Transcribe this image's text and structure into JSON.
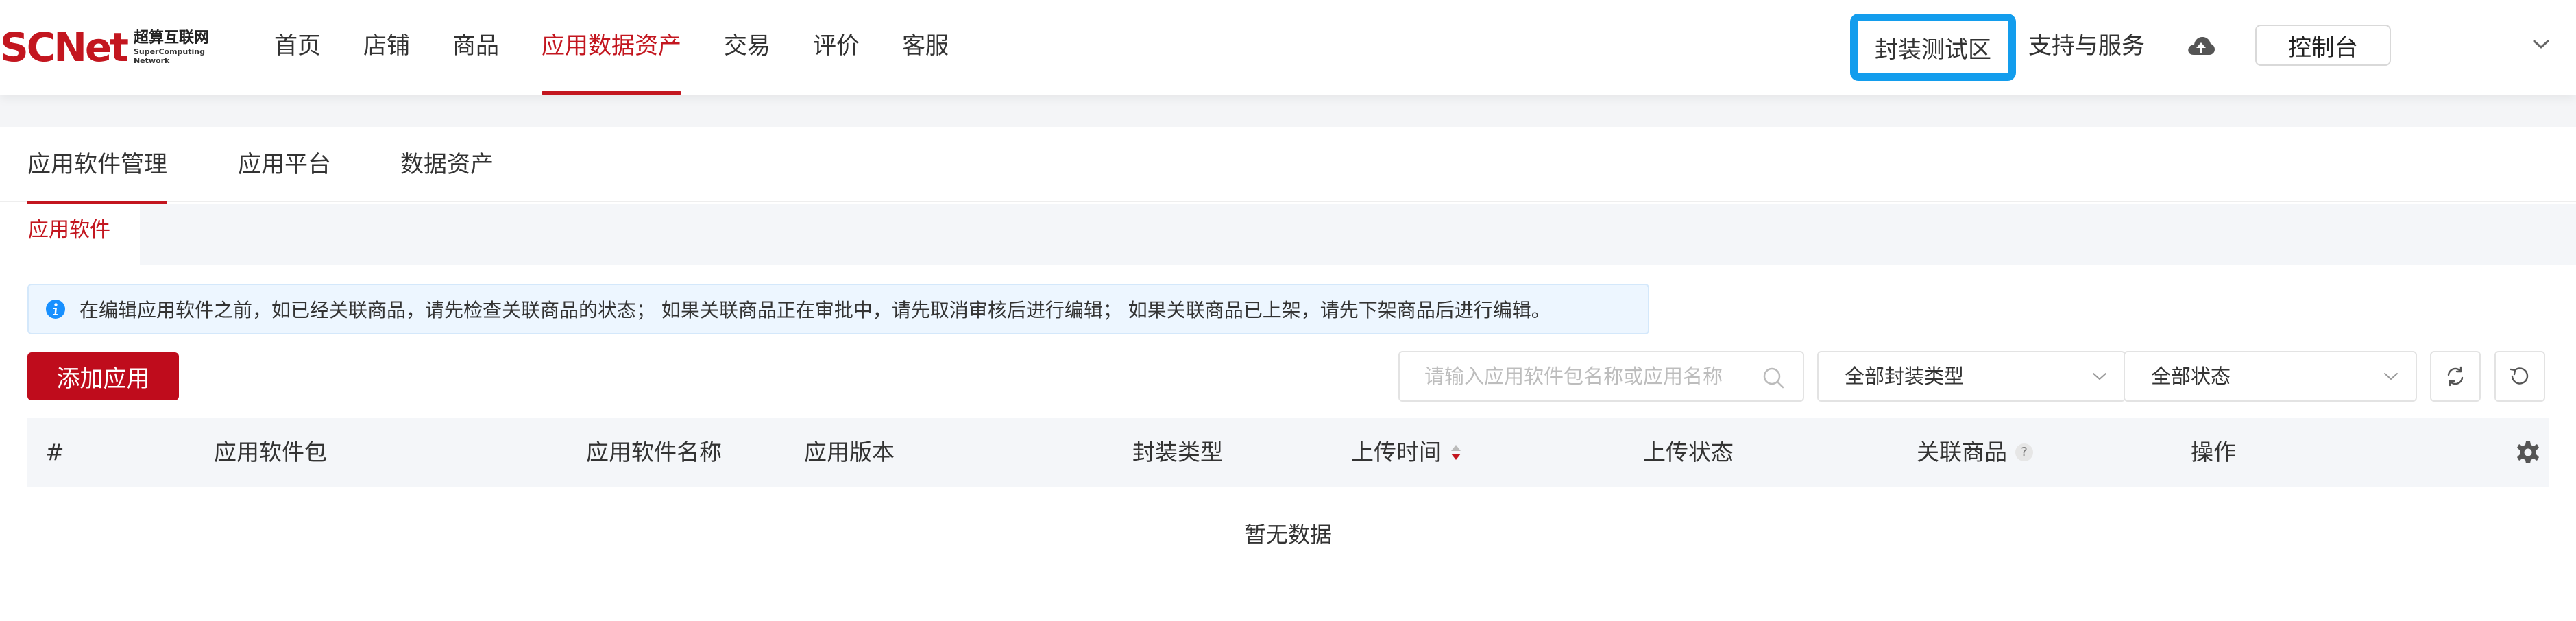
{
  "brand": {
    "logo_text": "SCNet",
    "name_cn": "超算互联网",
    "name_en_1": "SuperComputing",
    "name_en_2": "Network",
    "accent_color": "#c3161f"
  },
  "nav": {
    "items": [
      {
        "label": "首页"
      },
      {
        "label": "店铺"
      },
      {
        "label": "商品"
      },
      {
        "label": "应用数据资产",
        "active": true
      },
      {
        "label": "交易"
      },
      {
        "label": "评价"
      },
      {
        "label": "客服"
      }
    ],
    "test_zone": "封装测试区",
    "support": "支持与服务",
    "console": "控制台",
    "icons": [
      "cloud-upload-icon",
      "chevron-down-icon"
    ]
  },
  "tabs": [
    {
      "label": "应用软件管理",
      "active": true
    },
    {
      "label": "应用平台"
    },
    {
      "label": "数据资产"
    }
  ],
  "subtab": {
    "label": "应用软件"
  },
  "notice": {
    "text": "在编辑应用软件之前，如已经关联商品，请先检查关联商品的状态；  如果关联商品正在审批中，请先取消审核后进行编辑；  如果关联商品已上架，请先下架商品后进行编辑。"
  },
  "toolbar": {
    "add_label": "添加应用",
    "search_placeholder": "请输入应用软件包名称或应用名称",
    "type_select": "全部封装类型",
    "status_select": "全部状态"
  },
  "table": {
    "columns": [
      "#",
      "应用软件包",
      "应用软件名称",
      "应用版本",
      "封装类型",
      "上传时间",
      "上传状态",
      "关联商品",
      "操作"
    ],
    "rows": [],
    "empty_text": "暂无数据"
  }
}
